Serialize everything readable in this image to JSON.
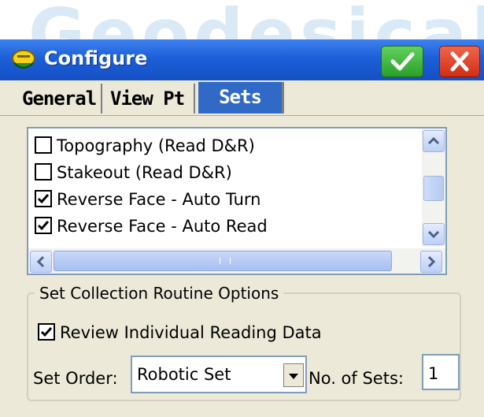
{
  "watermark": {
    "text": "Geodesical"
  },
  "window": {
    "title": "Configure",
    "ok_icon": "checkmark-icon",
    "close_icon": "close-icon",
    "colors": {
      "titlebar": "#1c5fd8",
      "ok": "#2aa02a",
      "close": "#d02e14"
    }
  },
  "tabs": [
    {
      "label": "General",
      "active": false
    },
    {
      "label": "View Pt",
      "active": false
    },
    {
      "label": "Sets",
      "active": true
    }
  ],
  "list": {
    "items": [
      {
        "label": "Topography (Read D&R)",
        "checked": false
      },
      {
        "label": "Stakeout (Read D&R)",
        "checked": false
      },
      {
        "label": "Reverse Face - Auto Turn",
        "checked": true
      },
      {
        "label": "Reverse Face - Auto Read",
        "checked": true
      }
    ]
  },
  "options": {
    "group_title": "Set Collection Routine Options",
    "review_label": "Review Individual Reading Data",
    "review_checked": true,
    "set_order_label": "Set Order:",
    "set_order_value": "Robotic Set",
    "num_sets_label": "No. of Sets:",
    "num_sets_value": "1"
  }
}
